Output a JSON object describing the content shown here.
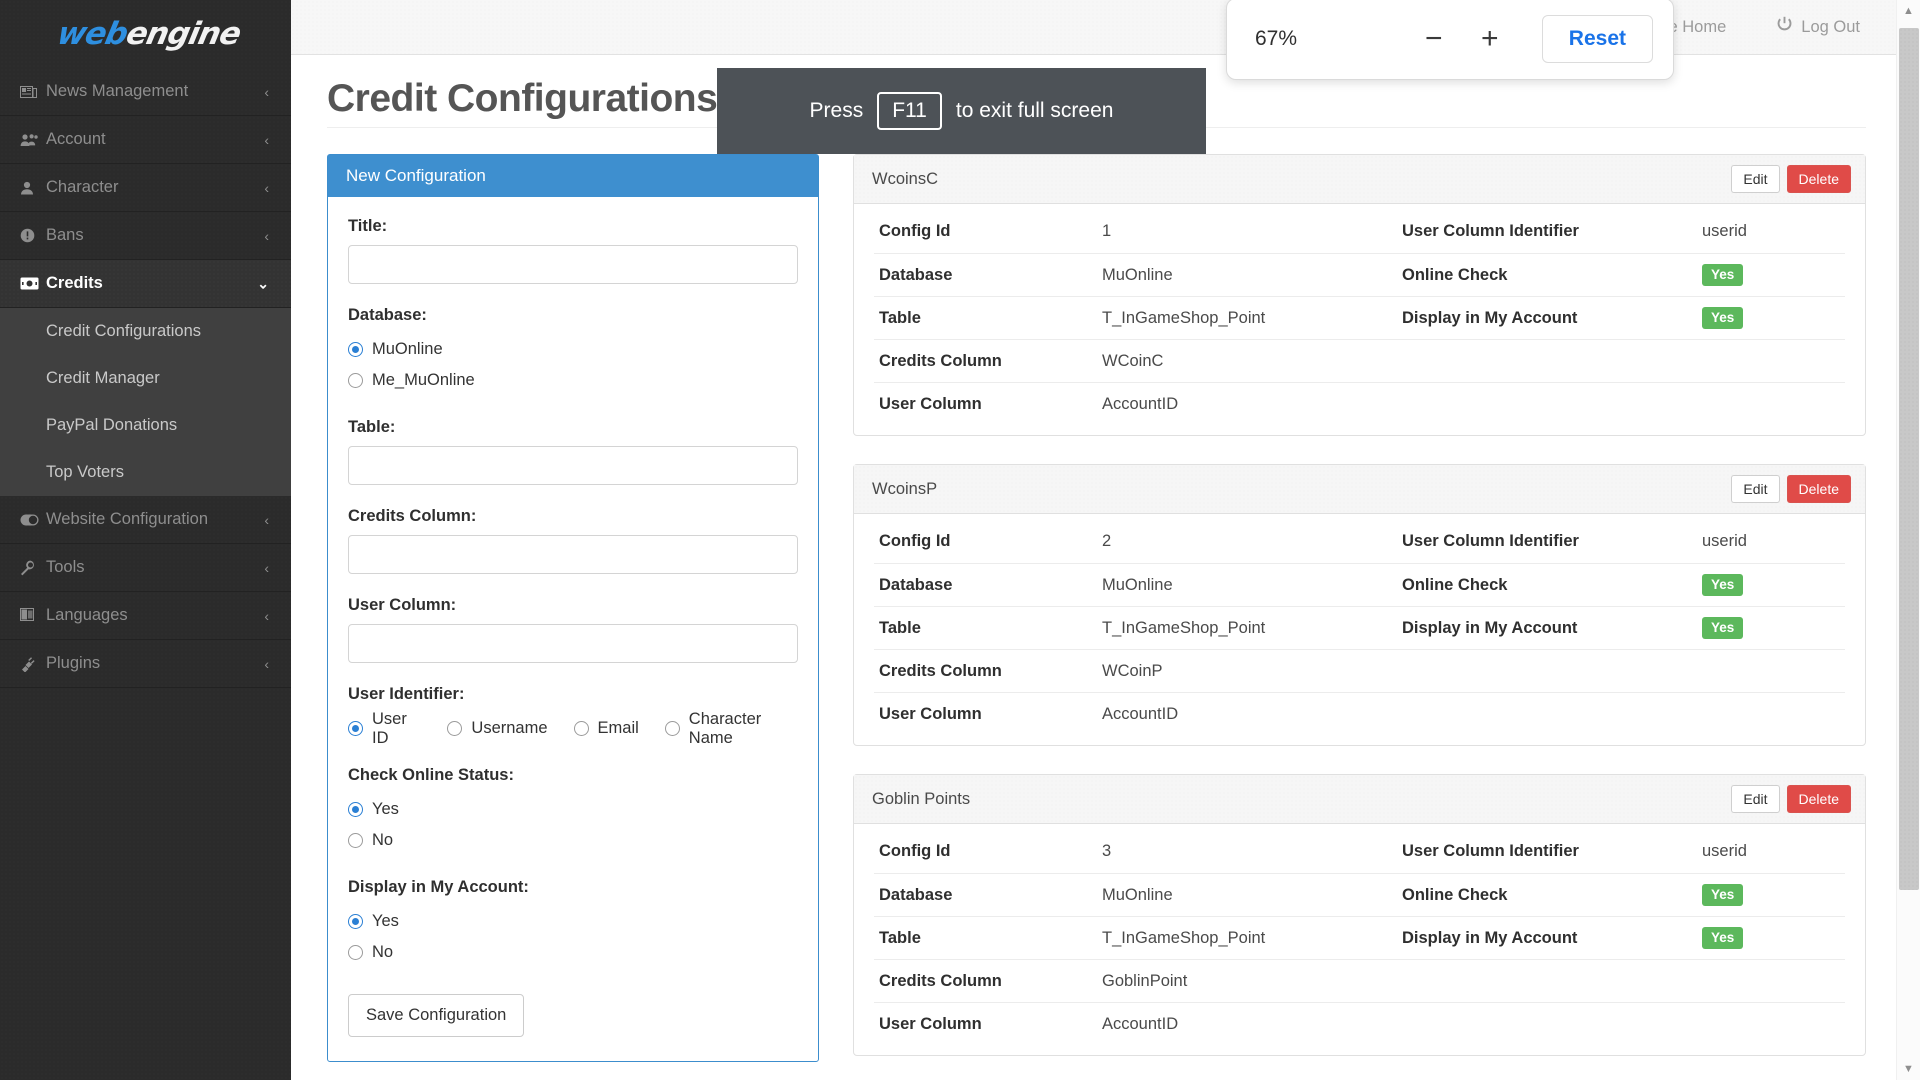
{
  "brand": {
    "part1": "web",
    "part2": "engine"
  },
  "accent": {
    "blue": "#3e8fcf",
    "green": "#5cb85c",
    "red": "#e04b48",
    "link": "#1a73e8"
  },
  "sidebar": {
    "items": [
      {
        "label": "News Management",
        "icon": "newspaper-icon",
        "chevron": "‹"
      },
      {
        "label": "Account",
        "icon": "users-icon",
        "chevron": "‹"
      },
      {
        "label": "Character",
        "icon": "user-icon",
        "chevron": "‹"
      },
      {
        "label": "Bans",
        "icon": "exclamation-circle-icon",
        "chevron": "‹"
      },
      {
        "label": "Credits",
        "icon": "money-bill-icon",
        "chevron": "⌄",
        "active": true
      },
      {
        "label": "Website Configuration",
        "icon": "toggle-icon",
        "chevron": "‹"
      },
      {
        "label": "Tools",
        "icon": "wrench-icon",
        "chevron": "‹"
      },
      {
        "label": "Languages",
        "icon": "flag-icon",
        "chevron": "‹"
      },
      {
        "label": "Plugins",
        "icon": "plug-icon",
        "chevron": "‹"
      }
    ],
    "submenu": [
      {
        "label": "Credit Configurations"
      },
      {
        "label": "Credit Manager"
      },
      {
        "label": "PayPal Donations"
      },
      {
        "label": "Top Voters"
      }
    ]
  },
  "topbar": {
    "links": [
      {
        "label": "Site Home",
        "icon": "home-icon"
      },
      {
        "label": "Log Out",
        "icon": "power-icon"
      }
    ]
  },
  "page": {
    "title": "Credit Configurations"
  },
  "zoom_popup": {
    "level": "67%",
    "minus": "−",
    "plus": "+",
    "reset_label": "Reset"
  },
  "fullscreen_toast": {
    "pre": "Press",
    "key": "F11",
    "post": "to exit full screen"
  },
  "form": {
    "header": "New Configuration",
    "title_label": "Title:",
    "title_value": "",
    "title_placeholder": "",
    "database_label": "Database:",
    "database_options": [
      {
        "label": "MuOnline",
        "selected": true
      },
      {
        "label": "Me_MuOnline",
        "selected": false
      }
    ],
    "table_label": "Table:",
    "table_value": "",
    "credits_column_label": "Credits Column:",
    "credits_column_value": "",
    "user_column_label": "User Column:",
    "user_column_value": "",
    "user_identifier_label": "User Identifier:",
    "user_identifier_options": [
      {
        "label": "User ID",
        "selected": true
      },
      {
        "label": "Username",
        "selected": false
      },
      {
        "label": "Email",
        "selected": false
      },
      {
        "label": "Character Name",
        "selected": false
      }
    ],
    "check_online_label": "Check Online Status:",
    "check_online_options": [
      {
        "label": "Yes",
        "selected": true
      },
      {
        "label": "No",
        "selected": false
      }
    ],
    "display_account_label": "Display in My Account:",
    "display_account_options": [
      {
        "label": "Yes",
        "selected": true
      },
      {
        "label": "No",
        "selected": false
      }
    ],
    "save_label": "Save Configuration"
  },
  "cards": {
    "edit_label": "Edit",
    "delete_label": "Delete",
    "labels": {
      "config_id": "Config Id",
      "database": "Database",
      "table": "Table",
      "credits_column": "Credits Column",
      "user_column": "User Column",
      "user_column_identifier": "User Column Identifier",
      "online_check": "Online Check",
      "display_in_my_account": "Display in My Account"
    },
    "items": [
      {
        "title": "WcoinsC",
        "config_id": "1",
        "database": "MuOnline",
        "table": "T_InGameShop_Point",
        "credits_column": "WCoinC",
        "user_column": "AccountID",
        "user_column_identifier": "userid",
        "online_check": "Yes",
        "display_in_my_account": "Yes"
      },
      {
        "title": "WcoinsP",
        "config_id": "2",
        "database": "MuOnline",
        "table": "T_InGameShop_Point",
        "credits_column": "WCoinP",
        "user_column": "AccountID",
        "user_column_identifier": "userid",
        "online_check": "Yes",
        "display_in_my_account": "Yes"
      },
      {
        "title": "Goblin Points",
        "config_id": "3",
        "database": "MuOnline",
        "table": "T_InGameShop_Point",
        "credits_column": "GoblinPoint",
        "user_column": "AccountID",
        "user_column_identifier": "userid",
        "online_check": "Yes",
        "display_in_my_account": "Yes"
      }
    ]
  },
  "scrollbar": {
    "up": "▲",
    "down": "▼"
  }
}
